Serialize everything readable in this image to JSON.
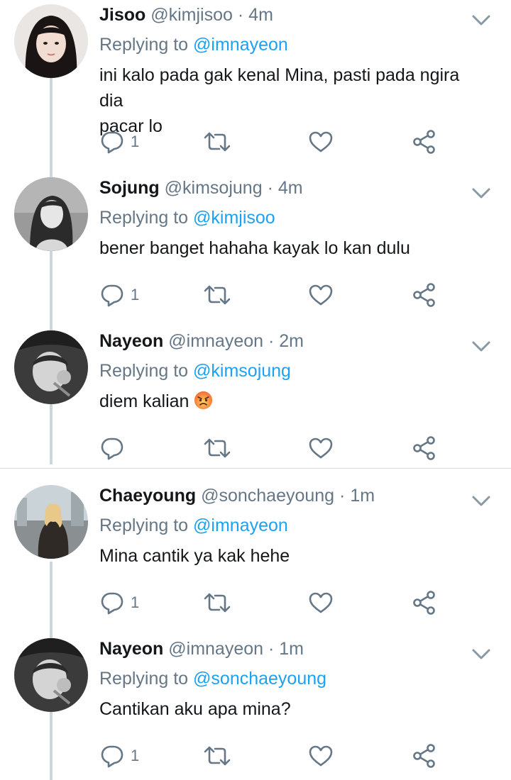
{
  "tweets": [
    {
      "name": "Jisoo",
      "handle": "@kimjisoo",
      "dot": "·",
      "time": "4m",
      "replying_label": "Replying to",
      "replying_to": "@imnayeon",
      "text_line1": "ini kalo pada gak kenal Mina, pasti pada ngira dia",
      "text_line2": "pacar lo",
      "reply_count": "1"
    },
    {
      "name": "Sojung",
      "handle": "@kimsojung",
      "dot": "·",
      "time": "4m",
      "replying_label": "Replying to",
      "replying_to": "@kimjisoo",
      "text": "bener banget hahaha kayak lo kan dulu",
      "reply_count": "1"
    },
    {
      "name": "Nayeon",
      "handle": "@imnayeon",
      "dot": "·",
      "time": "2m",
      "replying_label": "Replying to",
      "replying_to": "@kimsojung",
      "text": "diem kalian",
      "emoji": "angry-face",
      "reply_count": ""
    },
    {
      "name": "Chaeyoung",
      "handle": "@sonchaeyoung",
      "dot": "·",
      "time": "1m",
      "replying_label": "Replying to",
      "replying_to": "@imnayeon",
      "text": "Mina cantik ya kak hehe",
      "reply_count": "1"
    },
    {
      "name": "Nayeon",
      "handle": "@imnayeon",
      "dot": "·",
      "time": "1m",
      "replying_label": "Replying to",
      "replying_to": "@sonchaeyoung",
      "text": "Cantikan aku apa mina?",
      "reply_count": "1"
    }
  ],
  "icons": {
    "reply": "reply-icon",
    "retweet": "retweet-icon",
    "like": "heart-icon",
    "share": "share-icon",
    "more": "chevron-down-icon"
  },
  "colors": {
    "name": "#14171a",
    "secondary": "#657786",
    "mention": "#1da1f2",
    "thread_line": "#ccd6dd",
    "divider": "#d9d9d9"
  }
}
